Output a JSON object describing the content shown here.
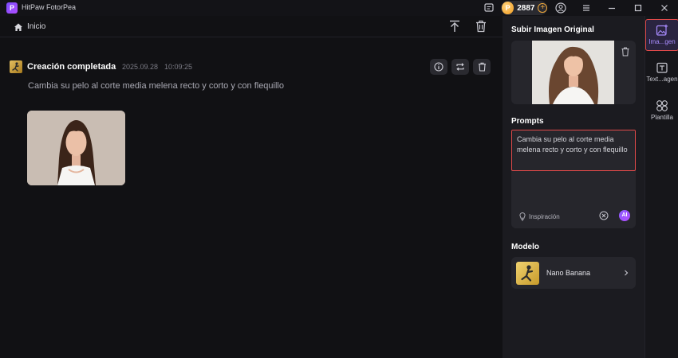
{
  "titlebar": {
    "app_name": "HitPaw FotorPea",
    "credits": "2887",
    "logo_letter": "P"
  },
  "topbar": {
    "home_label": "Inicio"
  },
  "result": {
    "title": "Creación completada",
    "date": "2025.09.28",
    "time": "10:09:25",
    "prompt": "Cambia su pelo al corte media melena recto y corto y con flequillo"
  },
  "panel": {
    "upload_heading": "Subir Imagen Original",
    "prompts_heading": "Prompts",
    "prompt_text": "Cambia su pelo al corte media melena recto y corto y con flequillo",
    "inspiration_label": "Inspiración",
    "ai_label": "AI",
    "model_heading": "Modelo",
    "model_name": "Nano Banana"
  },
  "rail": {
    "items": [
      {
        "label": "Ima...gen",
        "icon": "image-plus-icon",
        "active": true
      },
      {
        "label": "Text...agen",
        "icon": "text-image-icon",
        "active": false
      },
      {
        "label": "Plantilla",
        "icon": "grid-icon",
        "active": false
      }
    ]
  },
  "colors": {
    "accent": "#8a5cff",
    "highlight": "#e14a4a",
    "coin": "#f09a1f"
  }
}
